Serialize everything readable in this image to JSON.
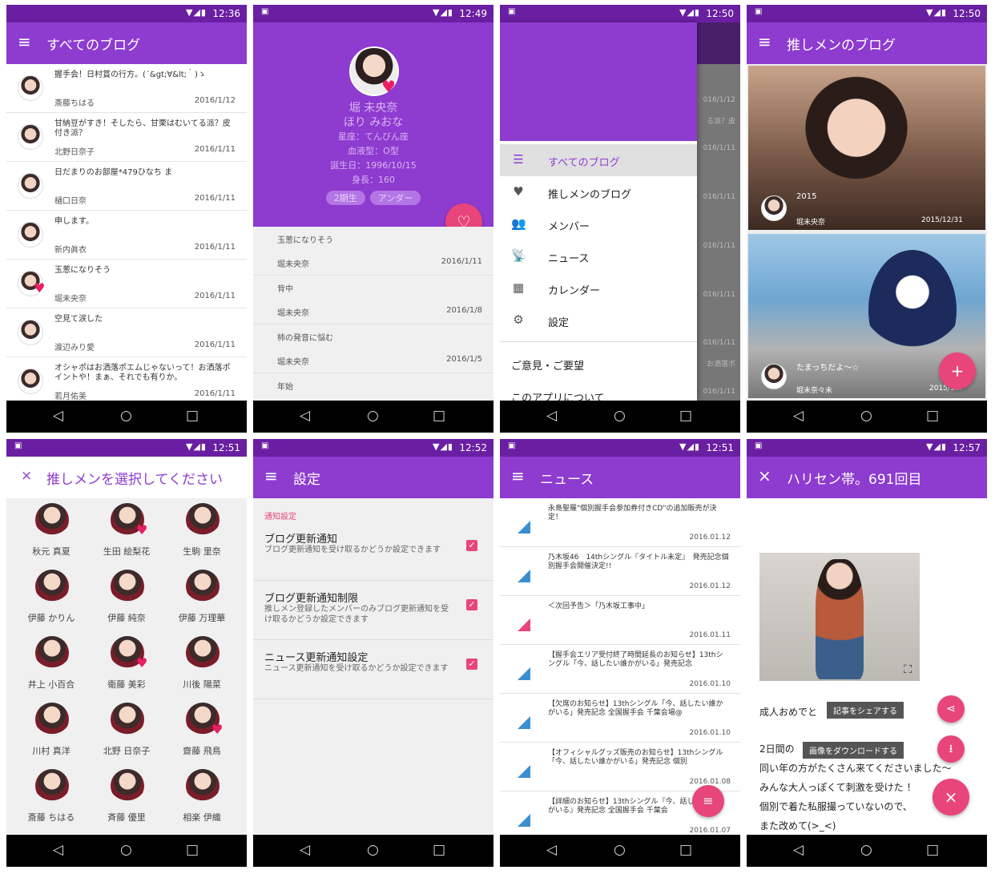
{
  "status_times": [
    "12:36",
    "12:49",
    "12:50",
    "12:50",
    "12:51",
    "12:52",
    "12:51",
    "12:57"
  ],
  "screen1": {
    "title": "すべてのブログ",
    "items": [
      {
        "title": "握手会！日村賞の行方。(´&gt;∀&lt;｀)ゝ",
        "author": "斎藤ちはる",
        "date": "2016/1/12"
      },
      {
        "title": "甘納豆がすき！そしたら、甘栗はむいてる派？皮付き派？",
        "author": "北野日奈子",
        "date": "2016/1/11"
      },
      {
        "title": "日だまりのお部屋*479ひなち ま",
        "author": "樋口日奈",
        "date": "2016/1/11"
      },
      {
        "title": "申します。",
        "author": "新内眞衣",
        "date": "2016/1/11"
      },
      {
        "title": "玉葱になりそう",
        "author": "堀未央奈",
        "date": "2016/1/11"
      },
      {
        "title": "空見て涙した",
        "author": "渡辺みり愛",
        "date": "2016/1/11"
      },
      {
        "title": "オシャポはお洒落ポエムじゃないって！お洒落ポイントや！まぁ、それでも有りか。",
        "author": "若月佑美",
        "date": "2016/1/11"
      }
    ]
  },
  "screen2": {
    "name": "堀 未央奈",
    "kana": "ほり みおな",
    "sign": "星座：てんびん座",
    "blood": "血液型：O型",
    "birth": "誕生日：1996/10/15",
    "height": "身長：160",
    "chips": [
      "2期生",
      "アンダー"
    ],
    "items": [
      {
        "title": "玉葱になりそう",
        "author": "堀未央奈",
        "date": "2016/1/11"
      },
      {
        "title": "背中",
        "author": "堀未央奈",
        "date": "2016/1/8"
      },
      {
        "title": "柿の発音に悩む",
        "author": "堀未央奈",
        "date": "2016/1/5"
      },
      {
        "title": "年始",
        "author": "",
        "date": ""
      }
    ]
  },
  "screen3": {
    "items": [
      {
        "label": "すべてのブログ",
        "icon": "☰"
      },
      {
        "label": "推しメンのブログ",
        "icon": "♥"
      },
      {
        "label": "メンバー",
        "icon": "👥"
      },
      {
        "label": "ニュース",
        "icon": "📡"
      },
      {
        "label": "カレンダー",
        "icon": "▦"
      },
      {
        "label": "設定",
        "icon": "⚙"
      }
    ],
    "feedback": "ご意見・ご要望",
    "about": "このアプリについて",
    "bg_dates": [
      "016/1/12",
      "る派？皮",
      "016/1/11",
      "016/1/11",
      "016/1/11",
      "016/1/11",
      "016/1/11",
      "お洒落ポ",
      "016/1/11"
    ]
  },
  "screen4": {
    "title": "推しメンのブログ",
    "photos": [
      {
        "title": "2015",
        "author": "堀未央奈",
        "date": "2015/12/31"
      },
      {
        "title": "たまっちだよ〜☆",
        "author": "堀未奈々未",
        "date": "2015/1..."
      }
    ]
  },
  "screen5": {
    "title": "推しメンを選択してください",
    "members": [
      "秋元 真夏",
      "生田 絵梨花",
      "生駒 里奈",
      "伊藤 かりん",
      "伊藤 純奈",
      "伊藤 万理華",
      "井上 小百合",
      "衛藤 美彩",
      "川後 陽菜",
      "川村 真洋",
      "北野 日奈子",
      "齋藤 飛鳥",
      "斎藤 ちはる",
      "斉藤 優里",
      "相楽 伊織"
    ]
  },
  "screen6": {
    "title": "設定",
    "section": "通知設定",
    "items": [
      {
        "title": "ブログ更新通知",
        "sub": "ブログ更新通知を受け取るかどうか設定できます"
      },
      {
        "title": "ブログ更新通知制限",
        "sub": "推しメン登録したメンバーのみブログ更新通知を受け取るかどうか設定できます"
      },
      {
        "title": "ニュース更新通知設定",
        "sub": "ニュース更新通知を受け取るかどうか設定できます"
      }
    ]
  },
  "screen7": {
    "title": "ニュース",
    "items": [
      {
        "title": "永島聖羅\"個別握手会参加券付きCD\"の追加販売が決定！",
        "date": "2016.01.12",
        "color": "blue"
      },
      {
        "title": "乃木坂46　14thシングル『タイトル未定』　発売記念個別握手会開催決定!!",
        "date": "2016.01.12",
        "color": "blue"
      },
      {
        "title": "＜次回予告＞「乃木坂工事中」",
        "date": "2016.01.11",
        "color": "pink"
      },
      {
        "title": "【握手会エリア受付終了時間延長のお知らせ】13thシングル「今、話したい誰かがいる」発売記念",
        "date": "2016.01.10",
        "color": "blue"
      },
      {
        "title": "【欠席のお知らせ】13thシングル「今、話したい誰かがいる」発売記念 全国握手会 千葉会場@",
        "date": "2016.01.10",
        "color": "blue"
      },
      {
        "title": "【オフィシャルグッズ販売のお知らせ】13thシングル「今、話したい誰かがいる」発売記念 個別",
        "date": "2016.01.08",
        "color": "blue"
      },
      {
        "title": "【詳細のお知らせ】13thシングル『今、話したい誰かがいる』発売記念 全国握手会 千葉会",
        "date": "2016.01.07",
        "color": "blue"
      }
    ]
  },
  "screen8": {
    "title": "ハリセン帯。691回目",
    "share_tip": "記事をシェアする",
    "download_tip": "画像をダウンロードする",
    "lines": [
      "成人おめでと",
      "2日間の",
      "同い年の方がたくさん来てくださいました〜",
      "みんな大人っぽくて刺激を受けた ！",
      "個別で着た私服撮っていないので、",
      "また改めて(>_<)"
    ]
  }
}
